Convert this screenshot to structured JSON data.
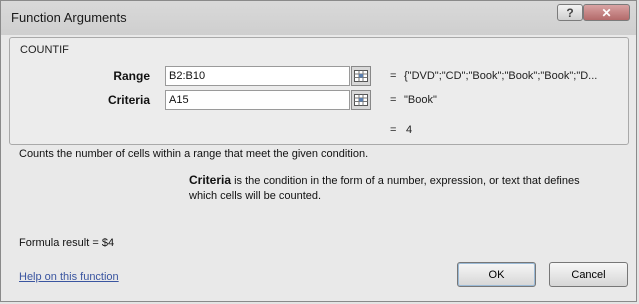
{
  "window": {
    "title": "Function Arguments",
    "help_glyph": "?",
    "close_glyph": "✕"
  },
  "function": {
    "name": "COUNTIF"
  },
  "arguments": [
    {
      "label": "Range",
      "input_value": "B2:B10",
      "equals": "=",
      "evaluated": "{\"DVD\";\"CD\";\"Book\";\"Book\";\"Book\";\"D..."
    },
    {
      "label": "Criteria",
      "input_value": "A15",
      "equals": "=",
      "evaluated": "\"Book\""
    }
  ],
  "result": {
    "equals": "=",
    "value": "4"
  },
  "description": "Counts the number of cells within a range that meet the given condition.",
  "argument_help": {
    "name": "Criteria",
    "text": "is the condition in the form of a number, expression, or text that defines which cells will be counted."
  },
  "formula_result": "Formula result =  $4",
  "help_link": "Help on this function",
  "buttons": {
    "ok": "OK",
    "cancel": "Cancel"
  }
}
